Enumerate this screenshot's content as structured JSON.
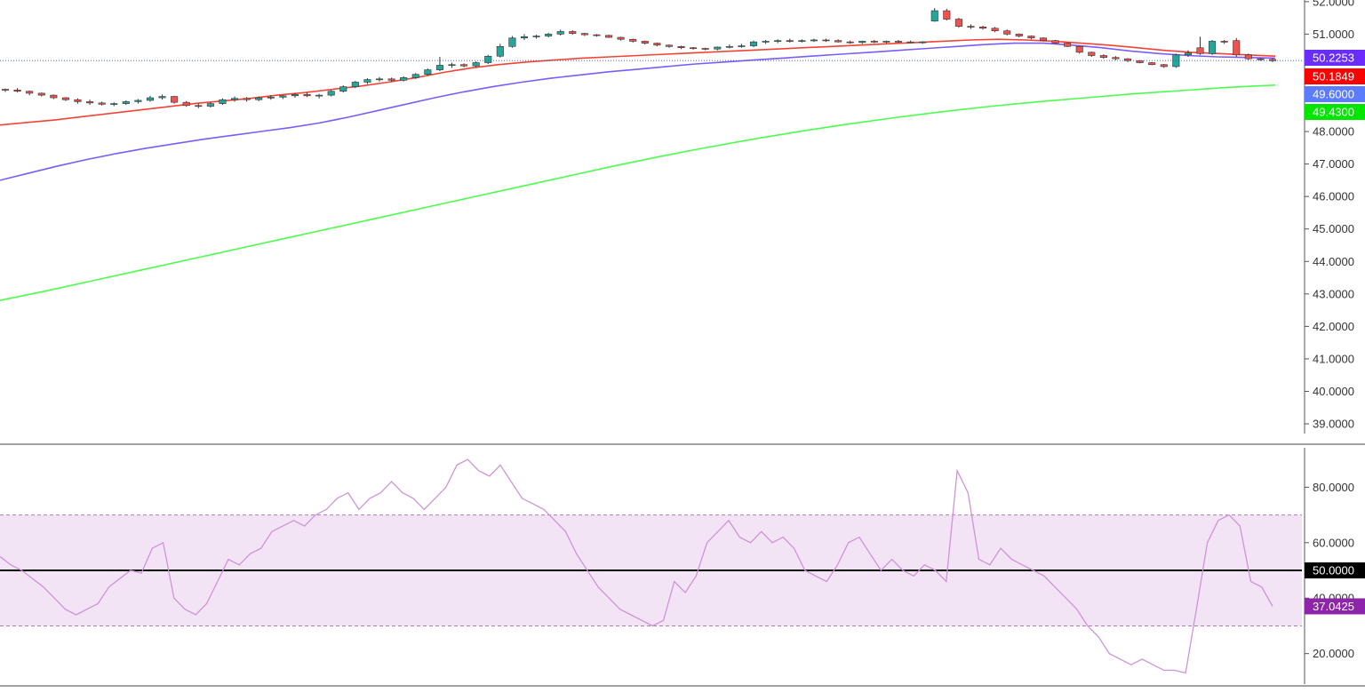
{
  "colors": {
    "up": "#26a69a",
    "down": "#ef5350",
    "ema_red": "#f44336",
    "ema_purple": "#7b5cff",
    "ema_green": "#4cff4c",
    "rsi_line": "#ce93d8",
    "rsi_band": "#f2e4f5",
    "last_price_line": "#3f51b5",
    "axis": "#555555",
    "tag_purple": "#6a2dff",
    "tag_red": "#ff0000",
    "tag_blue": "#5b7cff",
    "tag_green": "#00e600",
    "tag_black": "#000000",
    "tag_rsi": "#8e24aa"
  },
  "chart_data": [
    {
      "type": "candlestick",
      "yticks": [
        "39.0000",
        "40.0000",
        "41.0000",
        "42.0000",
        "43.0000",
        "44.0000",
        "45.0000",
        "46.0000",
        "47.0000",
        "48.0000",
        "51.0000",
        "52.0000"
      ],
      "ylim": [
        38.7,
        52.05
      ],
      "price_tags": [
        {
          "label": "50.2253",
          "value": 50.2253,
          "color": "tag_purple"
        },
        {
          "label": "50.1849",
          "value": 50.1849,
          "color": "tag_red"
        },
        {
          "label": "49.6000",
          "value": 49.6,
          "color": "tag_blue"
        },
        {
          "label": "49.4300",
          "value": 49.43,
          "color": "tag_green"
        }
      ],
      "last_price": 50.1849,
      "candles": [
        [
          49.3,
          49.32,
          49.22,
          49.28
        ],
        [
          49.28,
          49.34,
          49.2,
          49.24
        ],
        [
          49.24,
          49.26,
          49.12,
          49.18
        ],
        [
          49.18,
          49.2,
          49.08,
          49.12
        ],
        [
          49.12,
          49.14,
          49.0,
          49.04
        ],
        [
          49.04,
          49.06,
          48.94,
          48.98
        ],
        [
          48.98,
          49.02,
          48.86,
          48.92
        ],
        [
          48.92,
          48.98,
          48.82,
          48.88
        ],
        [
          48.88,
          48.92,
          48.8,
          48.84
        ],
        [
          48.84,
          48.9,
          48.78,
          48.86
        ],
        [
          48.86,
          48.96,
          48.82,
          48.92
        ],
        [
          48.92,
          49.0,
          48.86,
          48.96
        ],
        [
          48.96,
          49.1,
          48.92,
          49.04
        ],
        [
          49.04,
          49.14,
          48.98,
          49.08
        ],
        [
          49.08,
          49.1,
          48.86,
          48.9
        ],
        [
          48.9,
          48.94,
          48.76,
          48.8
        ],
        [
          48.8,
          48.86,
          48.72,
          48.78
        ],
        [
          48.78,
          48.9,
          48.74,
          48.86
        ],
        [
          48.86,
          49.02,
          48.82,
          48.98
        ],
        [
          48.98,
          49.08,
          48.92,
          49.02
        ],
        [
          49.02,
          49.06,
          48.92,
          48.98
        ],
        [
          48.98,
          49.08,
          48.94,
          49.04
        ],
        [
          49.04,
          49.12,
          48.98,
          49.06
        ],
        [
          49.06,
          49.12,
          49.0,
          49.1
        ],
        [
          49.1,
          49.18,
          49.04,
          49.14
        ],
        [
          49.14,
          49.2,
          49.06,
          49.1
        ],
        [
          49.1,
          49.16,
          49.02,
          49.12
        ],
        [
          49.12,
          49.28,
          49.08,
          49.24
        ],
        [
          49.24,
          49.42,
          49.2,
          49.38
        ],
        [
          49.38,
          49.56,
          49.34,
          49.52
        ],
        [
          49.52,
          49.64,
          49.46,
          49.6
        ],
        [
          49.6,
          49.68,
          49.54,
          49.62
        ],
        [
          49.62,
          49.66,
          49.54,
          49.58
        ],
        [
          49.58,
          49.7,
          49.54,
          49.66
        ],
        [
          49.66,
          49.8,
          49.62,
          49.76
        ],
        [
          49.76,
          49.94,
          49.72,
          49.9
        ],
        [
          49.9,
          50.3,
          49.86,
          50.04
        ],
        [
          50.04,
          50.12,
          49.96,
          50.06
        ],
        [
          50.06,
          50.1,
          49.98,
          50.02
        ],
        [
          50.02,
          50.16,
          49.98,
          50.12
        ],
        [
          50.12,
          50.36,
          50.08,
          50.32
        ],
        [
          50.32,
          50.7,
          50.28,
          50.62
        ],
        [
          50.62,
          50.94,
          50.58,
          50.88
        ],
        [
          50.88,
          51.0,
          50.82,
          50.92
        ],
        [
          50.92,
          50.98,
          50.86,
          50.94
        ],
        [
          50.94,
          51.04,
          50.9,
          51.0
        ],
        [
          51.0,
          51.14,
          50.96,
          51.08
        ],
        [
          51.08,
          51.12,
          50.98,
          51.02
        ],
        [
          51.02,
          51.04,
          50.94,
          50.98
        ],
        [
          50.98,
          51.0,
          50.92,
          50.96
        ],
        [
          50.96,
          50.98,
          50.88,
          50.9
        ],
        [
          50.9,
          50.92,
          50.8,
          50.84
        ],
        [
          50.84,
          50.86,
          50.74,
          50.78
        ],
        [
          50.78,
          50.8,
          50.68,
          50.72
        ],
        [
          50.72,
          50.74,
          50.62,
          50.66
        ],
        [
          50.66,
          50.68,
          50.58,
          50.62
        ],
        [
          50.62,
          50.64,
          50.54,
          50.58
        ],
        [
          50.58,
          50.6,
          50.52,
          50.56
        ],
        [
          50.56,
          50.58,
          50.5,
          50.54
        ],
        [
          50.54,
          50.62,
          50.5,
          50.6
        ],
        [
          50.6,
          50.68,
          50.56,
          50.62
        ],
        [
          50.62,
          50.7,
          50.58,
          50.64
        ],
        [
          50.64,
          50.8,
          50.6,
          50.76
        ],
        [
          50.76,
          50.82,
          50.7,
          50.78
        ],
        [
          50.78,
          50.84,
          50.72,
          50.8
        ],
        [
          50.8,
          50.86,
          50.74,
          50.78
        ],
        [
          50.78,
          50.84,
          50.74,
          50.8
        ],
        [
          50.8,
          50.86,
          50.76,
          50.82
        ],
        [
          50.82,
          50.86,
          50.76,
          50.8
        ],
        [
          50.8,
          50.84,
          50.74,
          50.76
        ],
        [
          50.76,
          50.8,
          50.7,
          50.74
        ],
        [
          50.74,
          50.8,
          50.7,
          50.78
        ],
        [
          50.78,
          50.82,
          50.72,
          50.76
        ],
        [
          50.76,
          50.8,
          50.72,
          50.78
        ],
        [
          50.78,
          50.82,
          50.74,
          50.76
        ],
        [
          50.76,
          50.8,
          50.72,
          50.74
        ],
        [
          50.74,
          50.78,
          50.7,
          50.76
        ],
        [
          51.4,
          51.8,
          51.38,
          51.72
        ],
        [
          51.72,
          51.78,
          51.42,
          51.46
        ],
        [
          51.46,
          51.5,
          51.2,
          51.24
        ],
        [
          51.24,
          51.3,
          51.16,
          51.22
        ],
        [
          51.22,
          51.26,
          51.14,
          51.18
        ],
        [
          51.18,
          51.22,
          51.06,
          51.1
        ],
        [
          51.1,
          51.14,
          50.96,
          51.0
        ],
        [
          51.0,
          51.02,
          50.9,
          50.94
        ],
        [
          50.94,
          50.96,
          50.84,
          50.88
        ],
        [
          50.88,
          50.9,
          50.78,
          50.8
        ],
        [
          50.8,
          50.82,
          50.7,
          50.72
        ],
        [
          50.72,
          50.74,
          50.6,
          50.62
        ],
        [
          50.62,
          50.64,
          50.4,
          50.44
        ],
        [
          50.44,
          50.46,
          50.3,
          50.34
        ],
        [
          50.34,
          50.38,
          50.24,
          50.28
        ],
        [
          50.28,
          50.32,
          50.2,
          50.24
        ],
        [
          50.24,
          50.26,
          50.14,
          50.18
        ],
        [
          50.18,
          50.2,
          50.1,
          50.12
        ],
        [
          50.12,
          50.14,
          50.04,
          50.06
        ],
        [
          50.06,
          50.08,
          49.96,
          50.0
        ],
        [
          50.0,
          50.4,
          49.96,
          50.36
        ],
        [
          50.36,
          50.5,
          50.3,
          50.42
        ],
        [
          50.58,
          50.92,
          50.36,
          50.4
        ],
        [
          50.4,
          50.82,
          50.36,
          50.78
        ],
        [
          50.78,
          50.82,
          50.7,
          50.76
        ],
        [
          50.8,
          50.88,
          50.3,
          50.36
        ],
        [
          50.36,
          50.4,
          50.2,
          50.24
        ],
        [
          50.24,
          50.26,
          50.18,
          50.22
        ],
        [
          50.22,
          50.26,
          50.14,
          50.18
        ]
      ],
      "ema_red": [
        48.2,
        48.28,
        48.36,
        48.46,
        48.56,
        48.66,
        48.76,
        48.86,
        48.94,
        49.02,
        49.12,
        49.2,
        49.3,
        49.4,
        49.52,
        49.66,
        49.82,
        49.96,
        50.06,
        50.14,
        50.2,
        50.26,
        50.3,
        50.34,
        50.38,
        50.42,
        50.46,
        50.5,
        50.54,
        50.58,
        50.62,
        50.66,
        50.7,
        50.74,
        50.78,
        50.82,
        50.84,
        50.82,
        50.78,
        50.72,
        50.66,
        50.58,
        50.5,
        50.44,
        50.4,
        50.36,
        50.32
      ],
      "ema_purple": [
        46.5,
        46.72,
        46.94,
        47.14,
        47.32,
        47.48,
        47.62,
        47.76,
        47.88,
        48.0,
        48.12,
        48.26,
        48.44,
        48.64,
        48.84,
        49.04,
        49.22,
        49.38,
        49.52,
        49.64,
        49.74,
        49.84,
        49.92,
        50.0,
        50.08,
        50.14,
        50.2,
        50.26,
        50.32,
        50.38,
        50.44,
        50.5,
        50.56,
        50.62,
        50.68,
        50.72,
        50.72,
        50.66,
        50.58,
        50.48,
        50.4,
        50.34,
        50.3,
        50.28,
        50.26
      ],
      "ema_green": [
        42.8,
        43.1,
        43.42,
        43.74,
        44.06,
        44.38,
        44.7,
        45.02,
        45.34,
        45.66,
        45.98,
        46.3,
        46.62,
        46.94,
        47.24,
        47.52,
        47.78,
        48.02,
        48.24,
        48.44,
        48.62,
        48.78,
        48.92,
        49.04,
        49.16,
        49.26,
        49.36,
        49.43
      ]
    },
    {
      "type": "line",
      "yticks": [
        "20.0000",
        "40.0000",
        "60.0000",
        "80.0000"
      ],
      "ylim": [
        9,
        95.5
      ],
      "bands": [
        30,
        50,
        70
      ],
      "tags": [
        {
          "label": "50.0000",
          "value": 50,
          "color": "tag_black"
        },
        {
          "label": "37.0425",
          "value": 37.0425,
          "color": "tag_rsi"
        }
      ],
      "values": [
        55,
        52,
        50,
        47,
        44,
        40,
        36,
        34,
        36,
        38,
        44,
        47,
        50,
        49,
        58,
        60,
        40,
        36,
        34,
        38,
        46,
        54,
        52,
        56,
        58,
        64,
        66,
        68,
        66,
        70,
        72,
        76,
        78,
        72,
        76,
        78,
        82,
        78,
        76,
        72,
        76,
        80,
        88,
        90,
        86,
        84,
        88,
        82,
        76,
        74,
        72,
        68,
        64,
        56,
        50,
        44,
        40,
        36,
        34,
        32,
        30,
        32,
        46,
        42,
        48,
        60,
        64,
        68,
        62,
        60,
        64,
        60,
        62,
        58,
        50,
        48,
        46,
        52,
        60,
        62,
        56,
        50,
        54,
        50,
        48,
        52,
        50,
        46,
        86,
        78,
        54,
        52,
        58,
        54,
        52,
        50,
        48,
        44,
        40,
        36,
        30,
        26,
        20,
        18,
        16,
        18,
        16,
        14,
        14,
        13,
        36,
        60,
        68,
        70,
        66,
        46,
        44,
        37.0425
      ]
    }
  ]
}
